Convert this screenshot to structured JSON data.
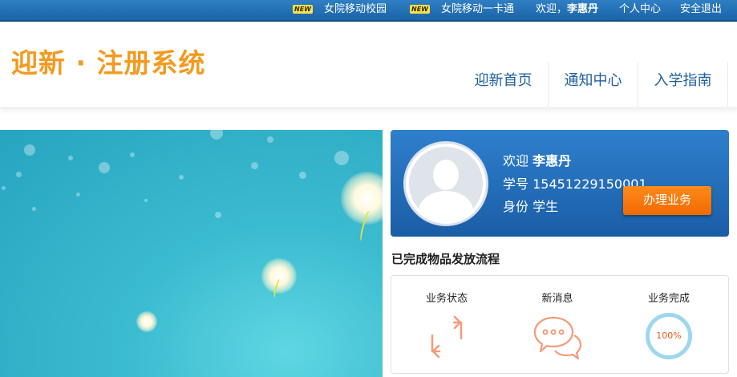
{
  "topbar": {
    "new_badge": "NEW",
    "link_campus": "女院移动校园",
    "link_card": "女院移动一卡通",
    "welcome_prefix": "欢迎，",
    "user_name": "李惠丹",
    "personal_center": "个人中心",
    "logout": "安全退出"
  },
  "header": {
    "logo_text": "迎新 · 注册系统",
    "nav": [
      "迎新首页",
      "通知中心",
      "入学指南"
    ]
  },
  "user": {
    "welcome_label": "欢迎",
    "name": "李惠丹",
    "id_label": "学号",
    "id_value": "15451229150001",
    "role_label": "身份",
    "role_value": "学生",
    "action_button": "办理业务"
  },
  "process": {
    "title": "已完成物品发放流程",
    "stats": [
      {
        "label": "业务状态",
        "icon": "refresh-arrows-icon"
      },
      {
        "label": "新消息",
        "icon": "chat-bubbles-icon"
      },
      {
        "label": "业务完成",
        "icon": "progress-ring",
        "value": "100%"
      }
    ]
  },
  "colors": {
    "topbar": "#1b64a8",
    "logo": "#f39a1f",
    "nav": "#1d5f9e",
    "accent_button": "#f07a10",
    "icon_orange": "#f59a7a",
    "ring": "#9fd6ee"
  }
}
